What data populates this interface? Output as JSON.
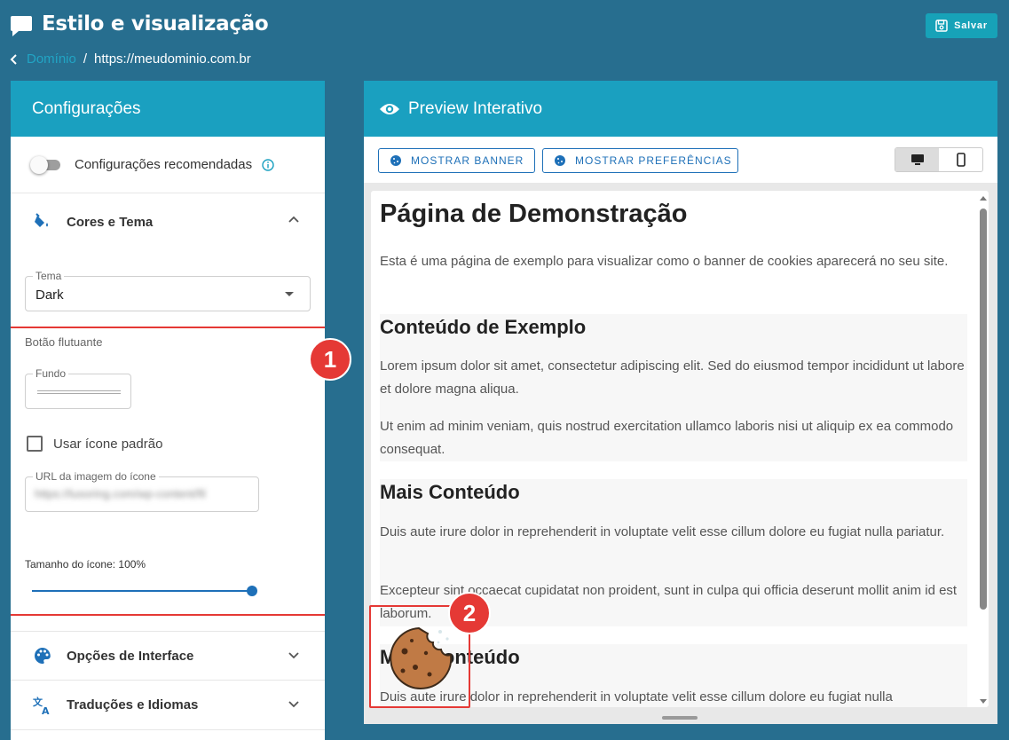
{
  "header": {
    "title": "Estilo e visualização",
    "save_label": "Salvar",
    "breadcrumb_link": "Domínio",
    "breadcrumb_sep": "/",
    "breadcrumb_current": "https://meudominio.com.br"
  },
  "left_panel": {
    "title": "Configurações",
    "recommended_label": "Configurações recomendadas",
    "recommended_enabled": false,
    "colors_section": {
      "title": "Cores e Tema",
      "expanded": true,
      "theme_label": "Tema",
      "theme_value": "Dark",
      "floating_button_label": "Botão flutuante",
      "background_label": "Fundo",
      "default_icon_label": "Usar ícone padrão",
      "default_icon_checked": false,
      "icon_url_label": "URL da imagem do ícone",
      "icon_url_value": "https://lusoring.com/wp-content/fil",
      "icon_size_label": "Tamanho do ícone: 100%",
      "icon_size_percent": 100
    },
    "interface_section": {
      "title": "Opções de Interface",
      "expanded": false
    },
    "translations_section": {
      "title": "Traduções e Idiomas",
      "expanded": false
    }
  },
  "right_panel": {
    "title": "Preview Interativo",
    "show_banner_label": "MOSTRAR BANNER",
    "show_prefs_label": "MOSTRAR PREFERÊNCIAS",
    "device_selected": "desktop"
  },
  "preview": {
    "h1": "Página de Demonstração",
    "intro": "Esta é uma página de exemplo para visualizar como o banner de cookies aparecerá no seu site.",
    "sec1_title": "Conteúdo de Exemplo",
    "sec1_p1": "Lorem ipsum dolor sit amet, consectetur adipiscing elit. Sed do eiusmod tempor incididunt ut labore et dolore magna aliqua.",
    "sec1_p2": "Ut enim ad minim veniam, quis nostrud exercitation ullamco laboris nisi ut aliquip ex ea commodo consequat.",
    "sec2_title": "Mais Conteúdo",
    "sec2_p1": "Duis aute irure dolor in reprehenderit in voluptate velit esse cillum dolore eu fugiat nulla pariatur.",
    "sec2_p2": "Excepteur sint occaecat cupidatat non proident, sunt in culpa qui officia deserunt mollit anim id est laborum.",
    "sec3_title": "Mais Conteúdo",
    "sec3_p1": "Duis aute irure dolor in reprehenderit in voluptate velit esse cillum dolore eu fugiat nulla"
  },
  "annotations": {
    "badge1": "1",
    "badge2": "2"
  },
  "colors": {
    "background": "#276e8f",
    "header_bar": "#1aa0c0",
    "accent": "#1e70b8",
    "highlight": "#e53935"
  }
}
